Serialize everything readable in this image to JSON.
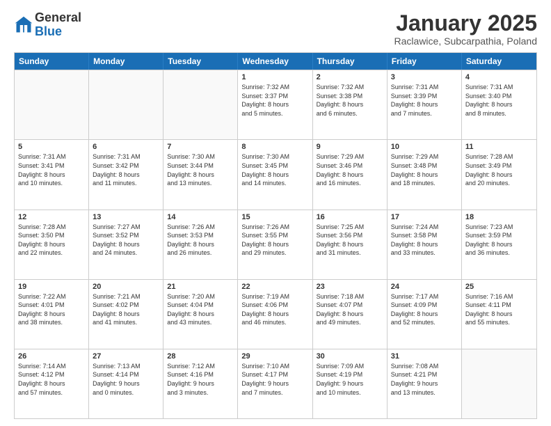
{
  "logo": {
    "general": "General",
    "blue": "Blue"
  },
  "title": "January 2025",
  "subtitle": "Raclawice, Subcarpathia, Poland",
  "header_days": [
    "Sunday",
    "Monday",
    "Tuesday",
    "Wednesday",
    "Thursday",
    "Friday",
    "Saturday"
  ],
  "rows": [
    [
      {
        "day": "",
        "info": "",
        "empty": true
      },
      {
        "day": "",
        "info": "",
        "empty": true
      },
      {
        "day": "",
        "info": "",
        "empty": true
      },
      {
        "day": "1",
        "info": "Sunrise: 7:32 AM\nSunset: 3:37 PM\nDaylight: 8 hours\nand 5 minutes."
      },
      {
        "day": "2",
        "info": "Sunrise: 7:32 AM\nSunset: 3:38 PM\nDaylight: 8 hours\nand 6 minutes."
      },
      {
        "day": "3",
        "info": "Sunrise: 7:31 AM\nSunset: 3:39 PM\nDaylight: 8 hours\nand 7 minutes."
      },
      {
        "day": "4",
        "info": "Sunrise: 7:31 AM\nSunset: 3:40 PM\nDaylight: 8 hours\nand 8 minutes."
      }
    ],
    [
      {
        "day": "5",
        "info": "Sunrise: 7:31 AM\nSunset: 3:41 PM\nDaylight: 8 hours\nand 10 minutes."
      },
      {
        "day": "6",
        "info": "Sunrise: 7:31 AM\nSunset: 3:42 PM\nDaylight: 8 hours\nand 11 minutes."
      },
      {
        "day": "7",
        "info": "Sunrise: 7:30 AM\nSunset: 3:44 PM\nDaylight: 8 hours\nand 13 minutes."
      },
      {
        "day": "8",
        "info": "Sunrise: 7:30 AM\nSunset: 3:45 PM\nDaylight: 8 hours\nand 14 minutes."
      },
      {
        "day": "9",
        "info": "Sunrise: 7:29 AM\nSunset: 3:46 PM\nDaylight: 8 hours\nand 16 minutes."
      },
      {
        "day": "10",
        "info": "Sunrise: 7:29 AM\nSunset: 3:48 PM\nDaylight: 8 hours\nand 18 minutes."
      },
      {
        "day": "11",
        "info": "Sunrise: 7:28 AM\nSunset: 3:49 PM\nDaylight: 8 hours\nand 20 minutes."
      }
    ],
    [
      {
        "day": "12",
        "info": "Sunrise: 7:28 AM\nSunset: 3:50 PM\nDaylight: 8 hours\nand 22 minutes."
      },
      {
        "day": "13",
        "info": "Sunrise: 7:27 AM\nSunset: 3:52 PM\nDaylight: 8 hours\nand 24 minutes."
      },
      {
        "day": "14",
        "info": "Sunrise: 7:26 AM\nSunset: 3:53 PM\nDaylight: 8 hours\nand 26 minutes."
      },
      {
        "day": "15",
        "info": "Sunrise: 7:26 AM\nSunset: 3:55 PM\nDaylight: 8 hours\nand 29 minutes."
      },
      {
        "day": "16",
        "info": "Sunrise: 7:25 AM\nSunset: 3:56 PM\nDaylight: 8 hours\nand 31 minutes."
      },
      {
        "day": "17",
        "info": "Sunrise: 7:24 AM\nSunset: 3:58 PM\nDaylight: 8 hours\nand 33 minutes."
      },
      {
        "day": "18",
        "info": "Sunrise: 7:23 AM\nSunset: 3:59 PM\nDaylight: 8 hours\nand 36 minutes."
      }
    ],
    [
      {
        "day": "19",
        "info": "Sunrise: 7:22 AM\nSunset: 4:01 PM\nDaylight: 8 hours\nand 38 minutes."
      },
      {
        "day": "20",
        "info": "Sunrise: 7:21 AM\nSunset: 4:02 PM\nDaylight: 8 hours\nand 41 minutes."
      },
      {
        "day": "21",
        "info": "Sunrise: 7:20 AM\nSunset: 4:04 PM\nDaylight: 8 hours\nand 43 minutes."
      },
      {
        "day": "22",
        "info": "Sunrise: 7:19 AM\nSunset: 4:06 PM\nDaylight: 8 hours\nand 46 minutes."
      },
      {
        "day": "23",
        "info": "Sunrise: 7:18 AM\nSunset: 4:07 PM\nDaylight: 8 hours\nand 49 minutes."
      },
      {
        "day": "24",
        "info": "Sunrise: 7:17 AM\nSunset: 4:09 PM\nDaylight: 8 hours\nand 52 minutes."
      },
      {
        "day": "25",
        "info": "Sunrise: 7:16 AM\nSunset: 4:11 PM\nDaylight: 8 hours\nand 55 minutes."
      }
    ],
    [
      {
        "day": "26",
        "info": "Sunrise: 7:14 AM\nSunset: 4:12 PM\nDaylight: 8 hours\nand 57 minutes."
      },
      {
        "day": "27",
        "info": "Sunrise: 7:13 AM\nSunset: 4:14 PM\nDaylight: 9 hours\nand 0 minutes."
      },
      {
        "day": "28",
        "info": "Sunrise: 7:12 AM\nSunset: 4:16 PM\nDaylight: 9 hours\nand 3 minutes."
      },
      {
        "day": "29",
        "info": "Sunrise: 7:10 AM\nSunset: 4:17 PM\nDaylight: 9 hours\nand 7 minutes."
      },
      {
        "day": "30",
        "info": "Sunrise: 7:09 AM\nSunset: 4:19 PM\nDaylight: 9 hours\nand 10 minutes."
      },
      {
        "day": "31",
        "info": "Sunrise: 7:08 AM\nSunset: 4:21 PM\nDaylight: 9 hours\nand 13 minutes."
      },
      {
        "day": "",
        "info": "",
        "empty": true
      }
    ]
  ]
}
